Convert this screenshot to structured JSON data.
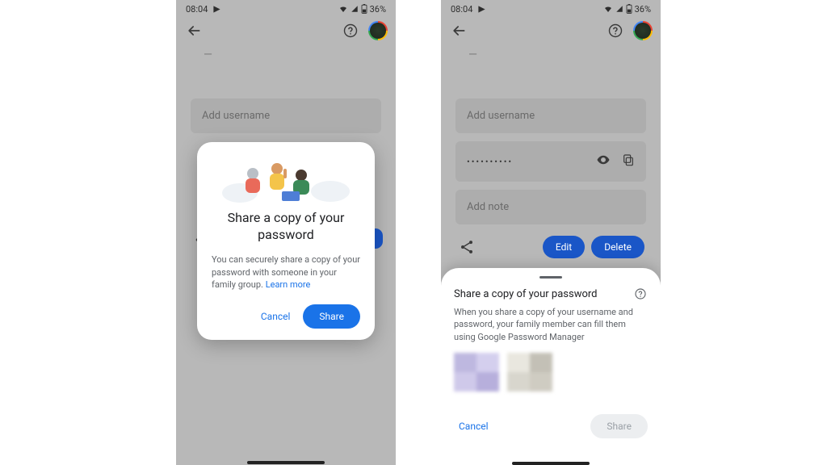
{
  "status_bar": {
    "time": "08:04",
    "battery_text": "36%"
  },
  "background_form": {
    "username_placeholder": "Add username",
    "password_value": "••••••••••",
    "note_placeholder": "Add note",
    "edit_label": "Edit",
    "delete_label": "Delete"
  },
  "dialog": {
    "title": "Share a copy of your password",
    "body": "You can securely share a copy of your password with someone in your family group.",
    "learn_more_label": "Learn more",
    "cancel_label": "Cancel",
    "share_label": "Share"
  },
  "sheet": {
    "title": "Share a copy of your password",
    "body": "When you share a copy of your username and password, your family member can fill them using Google Password Manager",
    "cancel_label": "Cancel",
    "share_label": "Share"
  }
}
